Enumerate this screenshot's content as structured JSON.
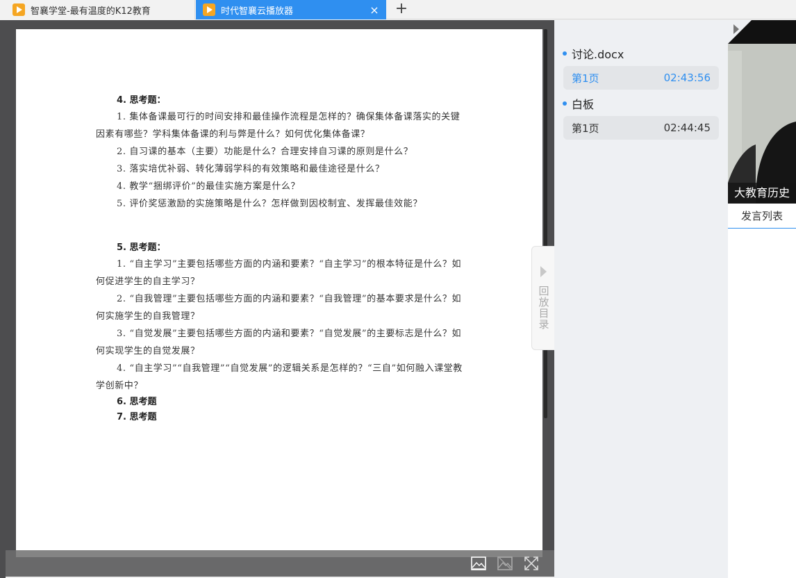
{
  "tabs": [
    {
      "title": "智襄学堂-最有温度的K12教育",
      "active": false
    },
    {
      "title": "时代智襄云播放器",
      "active": true,
      "close": "×"
    }
  ],
  "new_tab": "+",
  "document": {
    "sections": [
      {
        "heading": "4. 思考题：",
        "paragraphs": [
          "1. 集体备课最可行的时间安排和最佳操作流程是怎样的？确保集体备课落实的关键因素有哪些？学科集体备课的利与弊是什么？如何优化集体备课？",
          "2. 自习课的基本（主要）功能是什么？合理安排自习课的原则是什么？",
          "3. 落实培优补弱、转化薄弱学科的有效策略和最佳途径是什么？",
          "4. 教学“捆绑评价”的最佳实施方案是什么？",
          "5. 评价奖惩激励的实施策略是什么？怎样做到因校制宜、发挥最佳效能？"
        ]
      },
      {
        "heading": "5. 思考题：",
        "paragraphs": [
          "1. “自主学习”主要包括哪些方面的内涵和要素？“自主学习”的根本特征是什么？如何促进学生的自主学习？",
          "2. “自我管理”主要包括哪些方面的内涵和要素？“自我管理”的基本要求是什么？如何实施学生的自我管理？",
          "3. “自觉发展”主要包括哪些方面的内涵和要素？“自觉发展”的主要标志是什么？如何实现学生的自觉发展？",
          "4. “自主学习”“自我管理”“自觉发展”的逻辑关系是怎样的？“三自”如何融入课堂教学创新中？"
        ]
      }
    ],
    "tail_headings": [
      "6. 思考题",
      "7. 思考题"
    ]
  },
  "catalog_toggle": "回放目录",
  "playlist": [
    {
      "name": "讨论.docx",
      "entries": [
        {
          "page": "第1页",
          "time": "02:43:56",
          "active": true
        }
      ]
    },
    {
      "name": "白板",
      "entries": [
        {
          "page": "第1页",
          "time": "02:44:45",
          "active": false
        }
      ]
    }
  ],
  "video": {
    "caption": "大教育历史",
    "speak_list": "发言列表"
  },
  "colors": {
    "accent": "#2f8ff0",
    "viewer_bg": "#4d4d4f",
    "panel_bg": "#eef0f3"
  }
}
